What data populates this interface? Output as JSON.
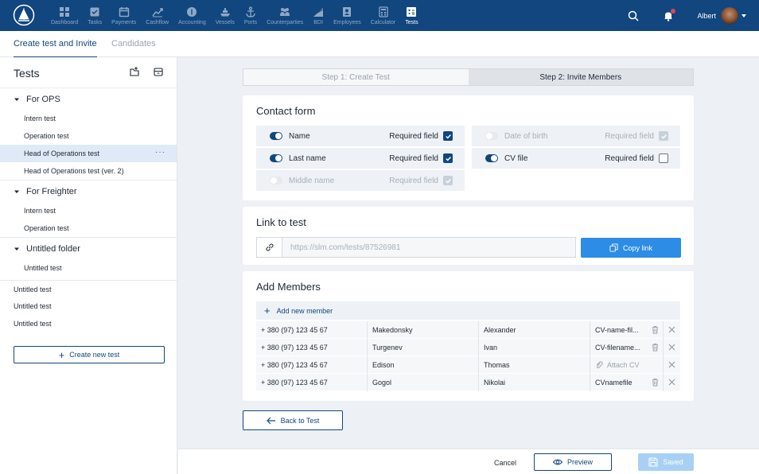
{
  "nav": {
    "items": [
      {
        "label": "Dashboard",
        "icon": "grid-icon"
      },
      {
        "label": "Tasks",
        "icon": "checkbox-icon"
      },
      {
        "label": "Payments",
        "icon": "calendar-icon"
      },
      {
        "label": "Cashflow",
        "icon": "trend-icon"
      },
      {
        "label": "Accounting",
        "icon": "coin-icon"
      },
      {
        "label": "Vessels",
        "icon": "ship-icon"
      },
      {
        "label": "Ports",
        "icon": "anchor-icon"
      },
      {
        "label": "Counterparties",
        "icon": "people-icon"
      },
      {
        "label": "BDI",
        "icon": "chart-icon"
      },
      {
        "label": "Employees",
        "icon": "badge-icon"
      },
      {
        "label": "Calculator",
        "icon": "calculator-icon"
      },
      {
        "label": "Tests",
        "icon": "tests-icon",
        "active": true
      }
    ],
    "user_name": "Albert"
  },
  "subtabs": {
    "create": "Create test and Invite",
    "candidates": "Candidates"
  },
  "sidebar": {
    "title": "Tests",
    "folders": [
      {
        "name": "For OPS",
        "tests": [
          "Intern test",
          "Operation test",
          "Head of Operations test",
          "Head of Operations test (ver. 2)"
        ]
      },
      {
        "name": "For Freighter",
        "tests": [
          "Intern test",
          "Operation test"
        ]
      },
      {
        "name": "Untitled folder",
        "tests": [
          "Untitled test"
        ]
      }
    ],
    "selected_test_menu": "···",
    "loose_tests": [
      "Untitled test",
      "Untitled test",
      "Untitled test"
    ],
    "create_label": "Create new test"
  },
  "steps": {
    "step1": "Step 1: Create Test",
    "step2": "Step 2: Invite Members"
  },
  "contact": {
    "title": "Contact form",
    "required_label": "Required field",
    "fields": [
      {
        "label": "Name",
        "enabled": true,
        "required": true
      },
      {
        "label": "Last name",
        "enabled": true,
        "required": true
      },
      {
        "label": "Middle name",
        "enabled": false,
        "required": true
      },
      {
        "label": "Date of birth",
        "enabled": false,
        "required": true
      },
      {
        "label": "CV file",
        "enabled": true,
        "required": false
      }
    ]
  },
  "link": {
    "title": "Link to test",
    "url": "https://slm.com/tests/87526981",
    "copy_label": "Copy link"
  },
  "members": {
    "title": "Add Members",
    "add_label": "Add new member",
    "attach_label": "Attach CV",
    "rows": [
      {
        "phone": "+ 380 (97) 123 45 67",
        "last": "Makedonsky",
        "first": "Alexander",
        "cv": "CV-name-fil..."
      },
      {
        "phone": "+ 380 (97) 123 45 67",
        "last": "Turgenev",
        "first": "Ivan",
        "cv": "CV-filename..."
      },
      {
        "phone": "+ 380 (97) 123 45 67",
        "last": "Edison",
        "first": "Thomas",
        "cv": ""
      },
      {
        "phone": "+ 380 (97) 123 45 67",
        "last": "Gogol",
        "first": "Nikolai",
        "cv": "CVnamefile"
      }
    ]
  },
  "buttons": {
    "back": "Back to Test",
    "cancel": "Cancel",
    "preview": "Preview",
    "saved": "Saved"
  },
  "colors": {
    "primary": "#11467e",
    "accent": "#2d8ce6",
    "selected": "#dfe9f7"
  }
}
